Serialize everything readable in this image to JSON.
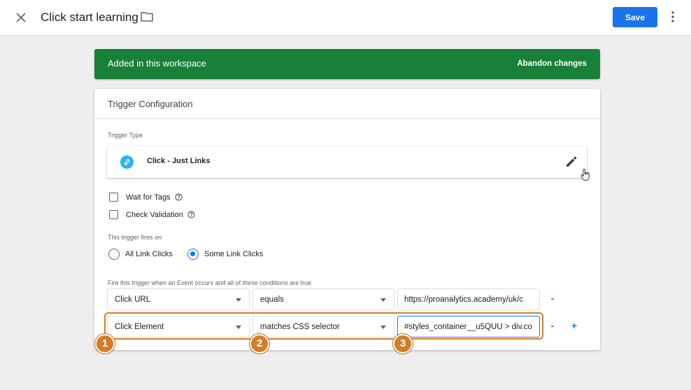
{
  "topbar": {
    "title": "Click start learning",
    "save_label": "Save"
  },
  "banner": {
    "text": "Added in this workspace",
    "action": "Abandon changes"
  },
  "card": {
    "title": "Trigger Configuration",
    "trigger_type_label": "Trigger Type",
    "trigger_type_name": "Click - Just Links",
    "checkboxes": [
      {
        "label": "Wait for Tags",
        "checked": false
      },
      {
        "label": "Check Validation",
        "checked": false
      }
    ],
    "fires_on_label": "This trigger fires on",
    "radios": [
      {
        "label": "All Link Clicks",
        "checked": false
      },
      {
        "label": "Some Link Clicks",
        "checked": true
      }
    ],
    "conditions_label": "Fire this trigger when an Event occurs and all of these conditions are true",
    "conditions": [
      {
        "variable": "Click URL",
        "operator": "equals",
        "value": "https://proanalytics.academy/uk/c"
      },
      {
        "variable": "Click Element",
        "operator": "matches CSS selector",
        "value": "#styles_container__u5QUU > div.co"
      }
    ],
    "remove_symbol": "-",
    "add_symbol": "+"
  },
  "annotations": [
    "1",
    "2",
    "3"
  ],
  "colors": {
    "accent": "#1a73e8",
    "banner": "#188038",
    "annotation": "#d37d28",
    "link_icon": "#2ab5ec"
  },
  "icons": [
    "close-icon",
    "folder-icon",
    "more-vert-icon",
    "link-icon",
    "edit-pencil-icon",
    "help-circle-icon",
    "hand-cursor-icon"
  ]
}
